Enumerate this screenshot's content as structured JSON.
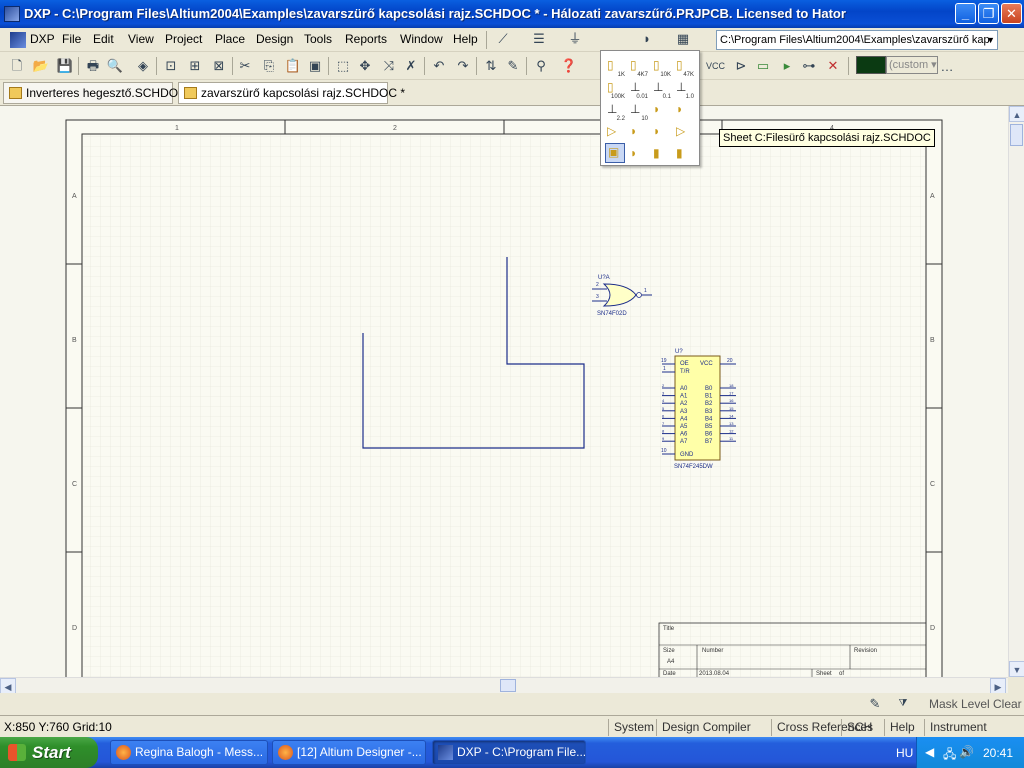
{
  "window": {
    "title": "DXP - C:\\Program Files\\Altium2004\\Examples\\zavarszürő kapcsolási rajz.SCHDOC * - Hálozati zavarszűrő.PRJPCB. Licensed to Hator",
    "min": "_",
    "max": "❐",
    "close": "✕"
  },
  "menu": {
    "items": [
      "DXP",
      "File",
      "Edit",
      "View",
      "Project",
      "Place",
      "Design",
      "Tools",
      "Reports",
      "Window",
      "Help"
    ],
    "path": "C:\\Program Files\\Altium2004\\Examples\\zavarszürő kap"
  },
  "toolbar": {
    "custom": "(custom",
    "color": "#0b3a12",
    "vcc": "VCC"
  },
  "tabs": [
    {
      "label": "Inverteres hegesztő.SCHDOC"
    },
    {
      "label": "zavarszürő kapcsolási rajz.SCHDOC *"
    }
  ],
  "palette": {
    "labels": [
      "1K",
      "4K7",
      "10K",
      "47K",
      "100K",
      "0.01",
      "0.1",
      "1.0",
      "2.2",
      "10"
    ]
  },
  "tooltip": "Sheet C:Filesürő kapcsolási rajz.SCHDOC",
  "sheet": {
    "col_labels": [
      "1",
      "2",
      "3",
      "4"
    ],
    "row_labels": [
      "A",
      "B",
      "C",
      "D"
    ],
    "titleblock": {
      "title": "Title",
      "size": "Size",
      "size_val": "A4",
      "number": "Number",
      "revision": "Revision",
      "date": "Date",
      "date_val": "2013.08.04",
      "sheet": "Sheet",
      "of": "of"
    },
    "gate": {
      "ref": "U?A",
      "part": "SN74F02D",
      "pin1": "1",
      "pin2": "2",
      "pin3": "3"
    },
    "ic": {
      "ref": "U?",
      "part": "SN74F245DW",
      "vcc": "VCC",
      "gnd": "GND",
      "oe": "OE",
      "tr": "T/R",
      "pin19": "19",
      "pin1": "1",
      "pin20": "20",
      "pin10": "10",
      "a_pins": [
        "A0",
        "A1",
        "A2",
        "A3",
        "A4",
        "A5",
        "A6",
        "A7"
      ],
      "b_pins": [
        "B0",
        "B1",
        "B2",
        "B3",
        "B4",
        "B5",
        "B6",
        "B7"
      ],
      "a_nums": [
        "2",
        "3",
        "4",
        "5",
        "6",
        "7",
        "8",
        "9"
      ],
      "b_nums": [
        "18",
        "17",
        "16",
        "15",
        "14",
        "13",
        "12",
        "11"
      ]
    }
  },
  "status_strip": {
    "mask_level": "Mask Level",
    "clear": "Clear"
  },
  "statusbar": {
    "coords": "X:850 Y:760   Grid:10",
    "panels": [
      "System",
      "Design Compiler",
      "Cross References",
      "SCH",
      "Help",
      "Instrument Racks"
    ]
  },
  "taskbar": {
    "start": "Start",
    "items": [
      "Regina Balogh - Mess...",
      "[12] Altium Designer -...",
      "DXP - C:\\Program File..."
    ],
    "lang": "HU",
    "clock": "20:41"
  }
}
